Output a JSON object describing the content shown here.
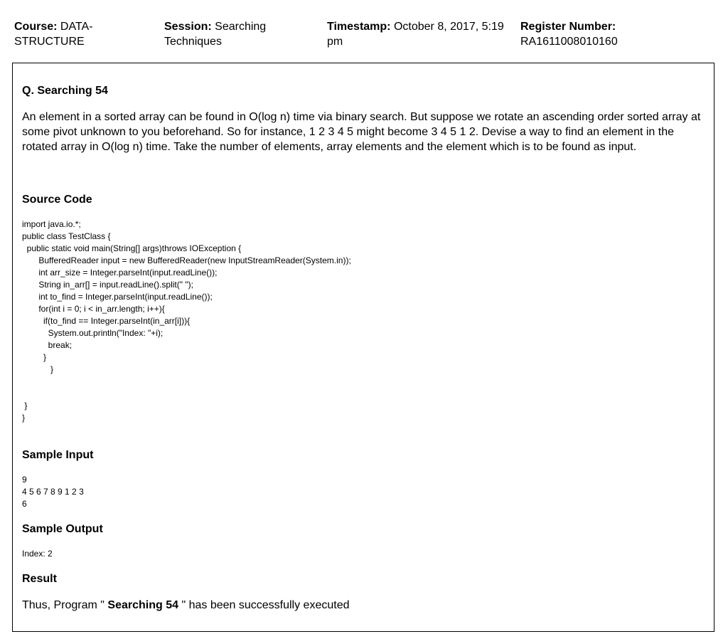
{
  "header": {
    "course_label": "Course:",
    "course_value": "DATA-STRUCTURE",
    "session_label": "Session:",
    "session_value": "Searching Techniques",
    "timestamp_label": "Timestamp:",
    "timestamp_value": "October 8, 2017, 5:19 pm",
    "register_label": "Register Number:",
    "register_value": "RA1611008010160"
  },
  "question": {
    "title": "Q. Searching 54",
    "description": "An element in a sorted array can be found in O(log n) time via binary search. But suppose we rotate an ascending order sorted array at some pivot unknown to you beforehand. So for instance, 1 2 3 4 5 might become 3 4 5 1 2. Devise a way to find an element in the rotated array in O(log n) time. Take the number of elements, array elements and the element which is to be found as input."
  },
  "source_code": {
    "heading": "Source Code",
    "code": "import java.io.*;\npublic class TestClass {\n  public static void main(String[] args)throws IOException {\n       BufferedReader input = new BufferedReader(new InputStreamReader(System.in));\n       int arr_size = Integer.parseInt(input.readLine());\n       String in_arr[] = input.readLine().split(\" \");\n       int to_find = Integer.parseInt(input.readLine());\n       for(int i = 0; i < in_arr.length; i++){\n         if(to_find == Integer.parseInt(in_arr[i])){\n           System.out.println(\"Index: \"+i);\n           break;\n         }\n            }\n\n\n }\n}"
  },
  "sample_input": {
    "heading": "Sample Input",
    "text": "9\n4 5 6 7 8 9 1 2 3\n6"
  },
  "sample_output": {
    "heading": "Sample Output",
    "text": "Index: 2"
  },
  "result": {
    "heading": "Result",
    "prefix": "Thus, Program \" ",
    "program_name": "Searching 54",
    "suffix": " \" has been successfully executed"
  }
}
